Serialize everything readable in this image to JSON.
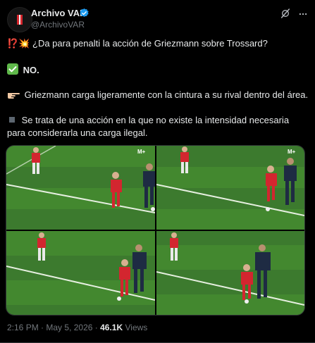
{
  "account": {
    "name": "Archivo VAR",
    "handle": "@ArchivoVAR"
  },
  "post": {
    "line1_emoji": "⁉️💥",
    "line1_text": "¿Da para penalti la acción de Griezmann sobre Trossard?",
    "line2_text": "NO.",
    "line3_text": "Griezmann carga ligeramente con la cintura a su rival dentro del área.",
    "line4_text": "Se trata de una acción en la que no existe la intensidad necesaria",
    "line5_text": "para considerarla una carga ilegal."
  },
  "media": {
    "panels": [
      "panel-1",
      "panel-2",
      "panel-3",
      "panel-4"
    ],
    "broadcaster_logo": "M+"
  },
  "meta": {
    "time": "2:16 PM",
    "date": "May 5, 2026",
    "views_count": "46.1K",
    "views_label": "Views"
  },
  "colors": {
    "background": "#000000",
    "text": "#e7e9ea",
    "secondary": "#71767b",
    "verified": "#1d9bf0",
    "pitch": "#3f7f2f"
  },
  "icons": [
    "club-logo-icon",
    "verified-badge-icon",
    "grok-icon",
    "more-icon",
    "check-emoji-icon",
    "pointing-hand-emoji-icon",
    "square-emoji-icon"
  ]
}
